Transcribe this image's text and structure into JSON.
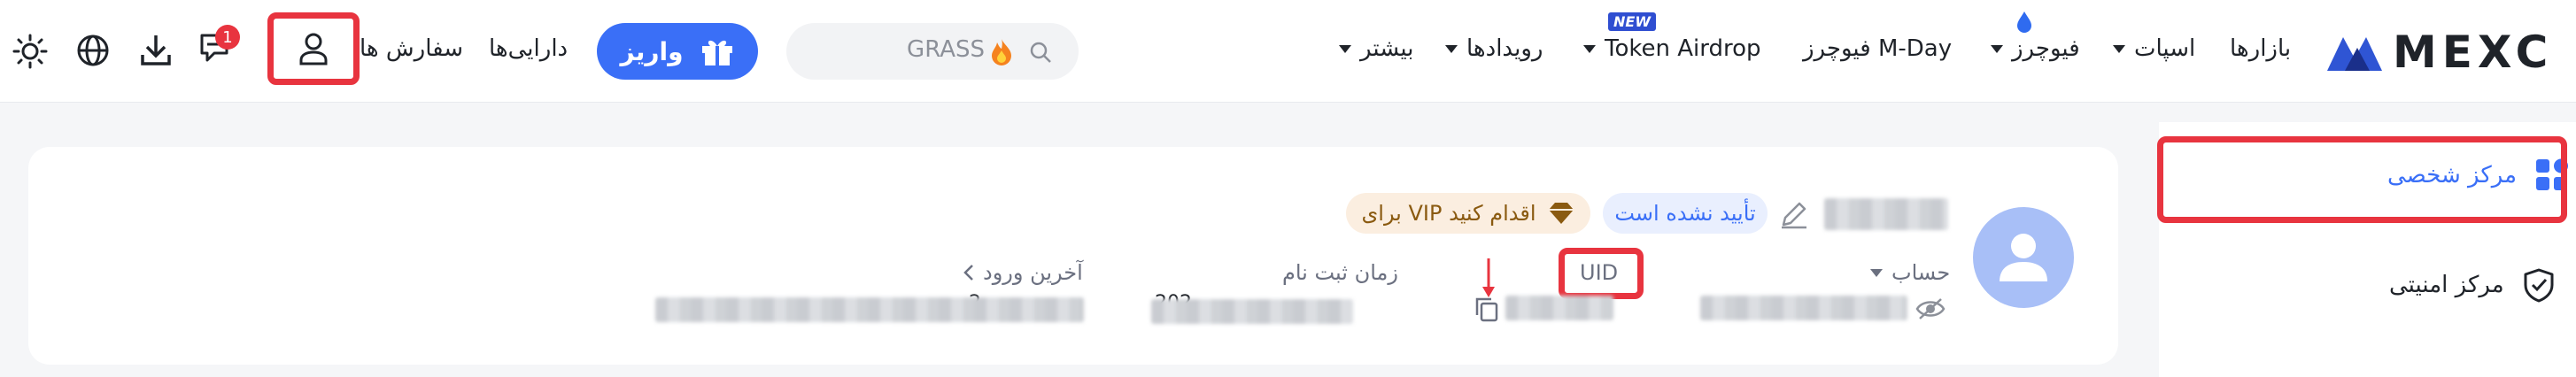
{
  "header": {
    "logo_text": "MEXC",
    "nav": {
      "markets": "بازارها",
      "spot": "اسپات",
      "futures": "فیوچرز",
      "mday": "فیوچرز M-Day",
      "token_airdrop": "Token Airdrop",
      "new_badge": "NEW",
      "events": "رویدادها",
      "more": "بیشتر"
    },
    "search_placeholder": "GRASS",
    "deposit_label": "واریز",
    "assets_label": "دارایی‌ها",
    "orders_label": "سفارش ها",
    "notification_count": "1"
  },
  "sidebar": {
    "items": [
      {
        "label": "مرکز شخصی",
        "active": true
      },
      {
        "label": "مرکز امنیتی",
        "active": false
      }
    ]
  },
  "profile": {
    "unverified_label": "تأیید نشده است",
    "vip_label": "برای VIP اقدام کنید",
    "account_label": "حساب",
    "uid_label": "UID",
    "registration_time_label": "زمان ثبت نام",
    "last_login_label": "آخرین ورود",
    "registration_time_partial": "202",
    "last_login_partial": "2"
  },
  "colors": {
    "brand_blue": "#3a6ff7",
    "highlight_red": "#e8343f",
    "vip_gold": "#8a5a10"
  }
}
